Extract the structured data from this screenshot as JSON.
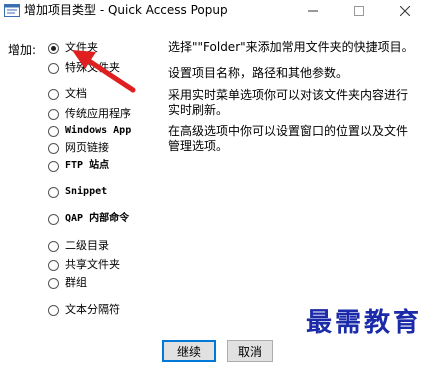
{
  "window": {
    "title": "增加项目类型 - Quick Access Popup",
    "minimize_icon": "minimize-icon",
    "maximize_icon": "maximize-icon",
    "close_icon": "close-icon"
  },
  "form": {
    "add_label": "增加:",
    "selected_option": "文件夹",
    "options": [
      {
        "label": "文件夹",
        "checked": true,
        "mono": false
      },
      {
        "label": "特殊文件夹",
        "checked": false,
        "mono": false
      },
      {
        "label": "文档",
        "checked": false,
        "mono": false
      },
      {
        "label": "传统应用程序",
        "checked": false,
        "mono": false
      },
      {
        "label": "Windows App",
        "checked": false,
        "mono": true
      },
      {
        "label": "网页链接",
        "checked": false,
        "mono": false
      },
      {
        "label": "FTP 站点",
        "checked": false,
        "mono": true
      },
      {
        "label": "Snippet",
        "checked": false,
        "mono": true
      },
      {
        "label": "QAP 内部命令",
        "checked": false,
        "mono": true
      },
      {
        "label": "二级目录",
        "checked": false,
        "mono": false
      },
      {
        "label": "共享文件夹",
        "checked": false,
        "mono": false
      },
      {
        "label": "群组",
        "checked": false,
        "mono": false
      },
      {
        "label": "文本分隔符",
        "checked": false,
        "mono": false
      }
    ]
  },
  "description": {
    "line1": "选择\"\"Folder\"来添加常用文件夹的快捷项目。",
    "line2": "设置项目名称，路径和其他参数。",
    "line3": "采用实时菜单选项你可以对该文件夹内容进行实时刷新。",
    "line4": "在高级选项中你可以设置窗口的位置以及文件管理选项。"
  },
  "buttons": {
    "continue": "继续",
    "cancel": "取消"
  },
  "watermark": "最需教育",
  "colors": {
    "arrow": "#e02020",
    "watermark": "#1a2aa8",
    "focus_border": "#0078d7"
  }
}
